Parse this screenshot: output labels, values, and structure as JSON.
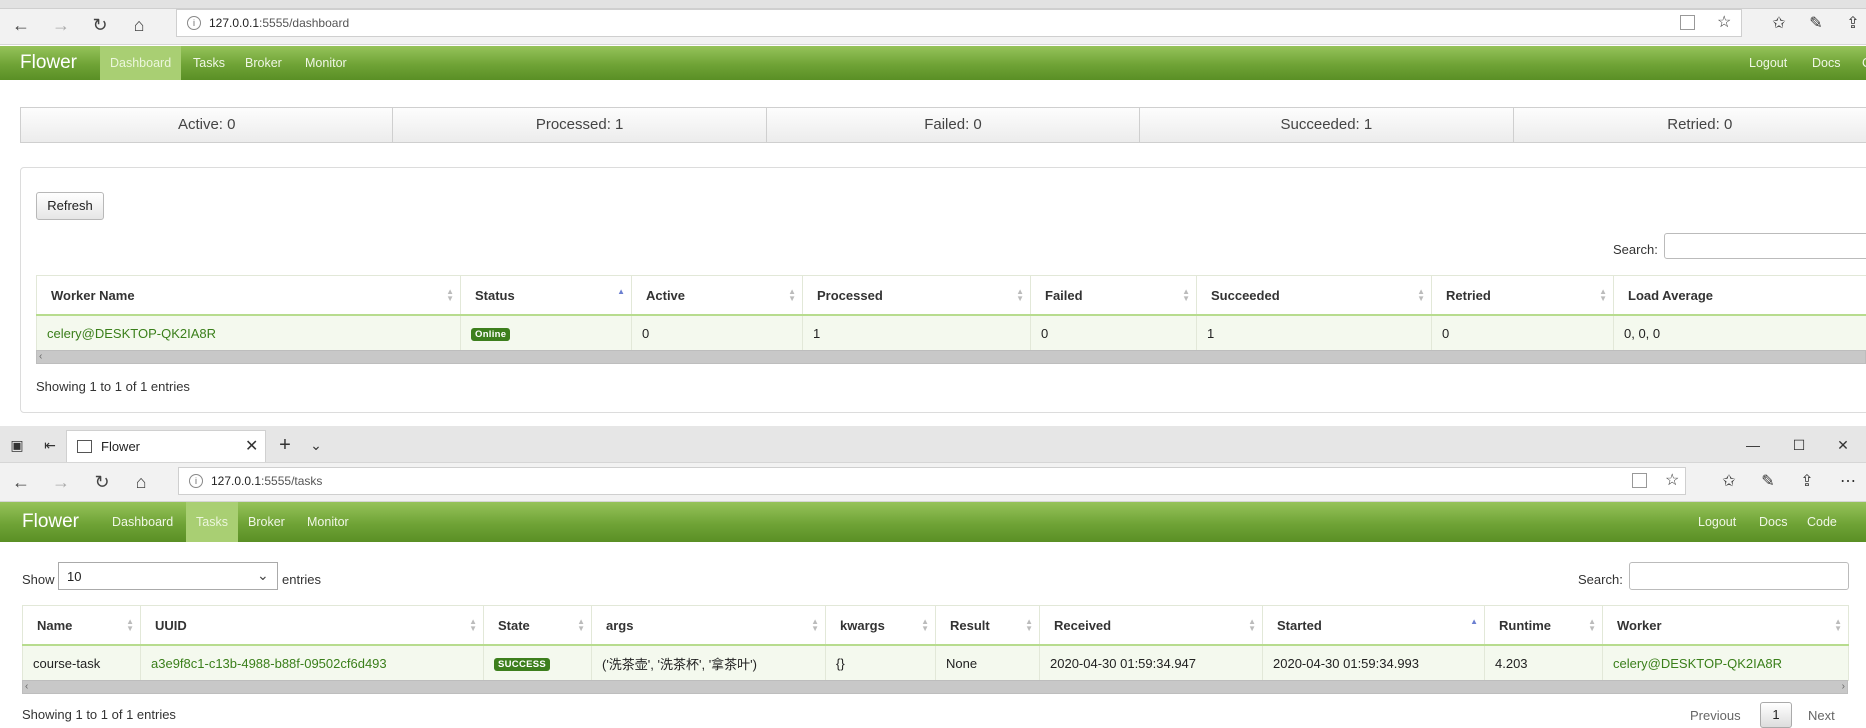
{
  "window1": {
    "url_host": "127.0.0.1",
    "url_rest": ":5555/dashboard",
    "brand": "Flower",
    "nav": [
      "Dashboard",
      "Tasks",
      "Broker",
      "Monitor"
    ],
    "nav_right": [
      "Logout",
      "Docs",
      "C"
    ],
    "stats": [
      "Active: 0",
      "Processed: 1",
      "Failed: 0",
      "Succeeded: 1",
      "Retried: 0"
    ],
    "refresh_label": "Refresh",
    "search_label": "Search:",
    "table": {
      "headers": [
        "Worker Name",
        "Status",
        "Active",
        "Processed",
        "Failed",
        "Succeeded",
        "Retried",
        "Load Average"
      ],
      "row": {
        "worker": "celery@DESKTOP-QK2IA8R",
        "status": "Online",
        "active": "0",
        "processed": "1",
        "failed": "0",
        "succeeded": "1",
        "retried": "0",
        "load": "0, 0, 0"
      }
    },
    "info": "Showing 1 to 1 of 1 entries"
  },
  "window2": {
    "tab_title": "Flower",
    "url_host": "127.0.0.1",
    "url_rest": ":5555/tasks",
    "brand": "Flower",
    "nav": [
      "Dashboard",
      "Tasks",
      "Broker",
      "Monitor"
    ],
    "nav_right": [
      "Logout",
      "Docs",
      "Code"
    ],
    "show_label": "Show",
    "show_value": "10",
    "entries_label": "entries",
    "search_label": "Search:",
    "table": {
      "headers": [
        "Name",
        "UUID",
        "State",
        "args",
        "kwargs",
        "Result",
        "Received",
        "Started",
        "Runtime",
        "Worker"
      ],
      "row": {
        "name": "course-task",
        "uuid": "a3e9f8c1-c13b-4988-b88f-09502cf6d493",
        "state": "SUCCESS",
        "args": "('洗茶壶', '洗茶杯', '拿茶叶')",
        "kwargs": "{}",
        "result": "None",
        "received": "2020-04-30 01:59:34.947",
        "started": "2020-04-30 01:59:34.993",
        "runtime": "4.203",
        "worker": "celery@DESKTOP-QK2IA8R"
      }
    },
    "info": "Showing 1 to 1 of 1 entries",
    "pager": {
      "previous": "Previous",
      "page": "1",
      "next": "Next"
    }
  }
}
